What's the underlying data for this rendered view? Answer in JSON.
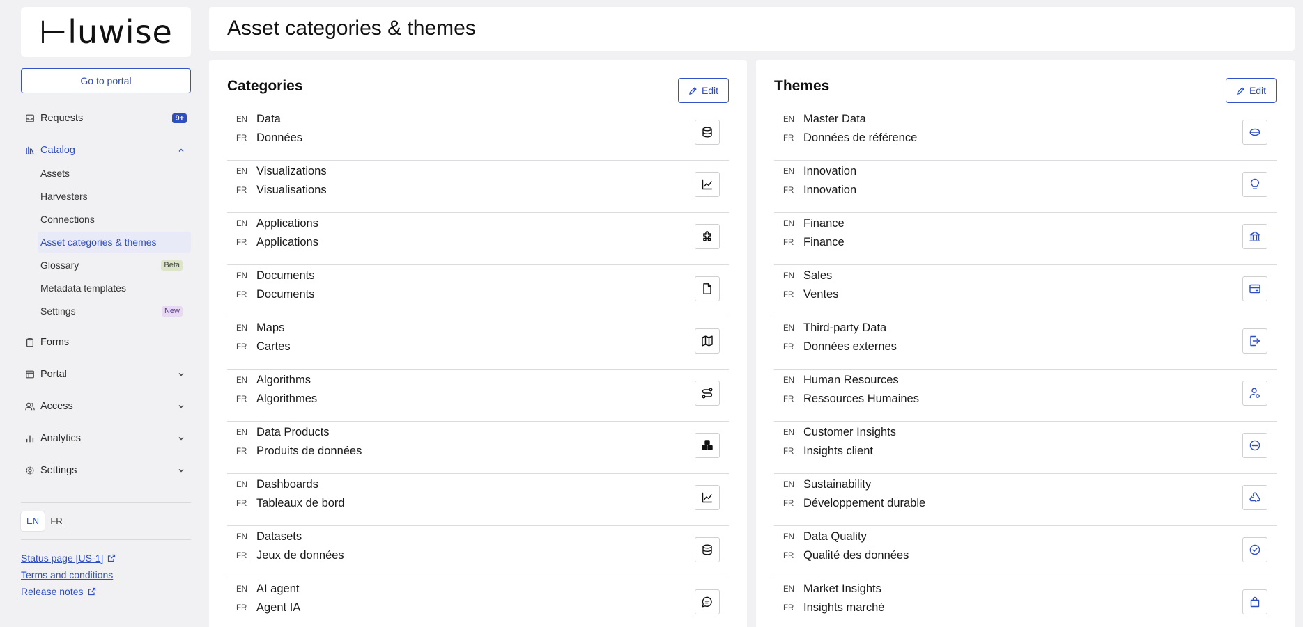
{
  "sidebar": {
    "logo": "⊢luwise",
    "portal_button": "Go to portal",
    "nav": {
      "requests": {
        "label": "Requests",
        "badge": "9+"
      },
      "catalog": {
        "label": "Catalog"
      },
      "catalog_items": {
        "assets": "Assets",
        "harvesters": "Harvesters",
        "connections": "Connections",
        "asset_categories": "Asset categories & themes",
        "glossary": "Glossary",
        "glossary_tag": "Beta",
        "metadata_templates": "Metadata templates",
        "settings": "Settings",
        "settings_tag": "New"
      },
      "forms": {
        "label": "Forms"
      },
      "portal": {
        "label": "Portal"
      },
      "access": {
        "label": "Access"
      },
      "analytics": {
        "label": "Analytics"
      },
      "settings": {
        "label": "Settings"
      }
    },
    "languages": [
      "EN",
      "FR"
    ],
    "links": {
      "status": "Status page [US-1]",
      "terms": "Terms and conditions",
      "release": "Release notes"
    }
  },
  "page": {
    "title": "Asset categories & themes"
  },
  "categories": {
    "title": "Categories",
    "edit_label": "Edit",
    "items": [
      {
        "en": "Data",
        "fr": "Données",
        "icon": "database-icon"
      },
      {
        "en": "Visualizations",
        "fr": "Visualisations",
        "icon": "line-chart-icon"
      },
      {
        "en": "Applications",
        "fr": "Applications",
        "icon": "puzzle-icon"
      },
      {
        "en": "Documents",
        "fr": "Documents",
        "icon": "file-icon"
      },
      {
        "en": "Maps",
        "fr": "Cartes",
        "icon": "map-icon"
      },
      {
        "en": "Algorithms",
        "fr": "Algorithmes",
        "icon": "route-icon"
      },
      {
        "en": "Data Products",
        "fr": "Produits de données",
        "icon": "boxes-icon"
      },
      {
        "en": "Dashboards",
        "fr": "Tableaux de bord",
        "icon": "line-chart-icon"
      },
      {
        "en": "Datasets",
        "fr": "Jeux de données",
        "icon": "database-icon"
      },
      {
        "en": "AI agent",
        "fr": "Agent IA",
        "icon": "chat-icon"
      }
    ]
  },
  "themes": {
    "title": "Themes",
    "edit_label": "Edit",
    "items": [
      {
        "en": "Master Data",
        "fr": "Données de référence",
        "icon": "disc-icon"
      },
      {
        "en": "Innovation",
        "fr": "Innovation",
        "icon": "lightbulb-icon"
      },
      {
        "en": "Finance",
        "fr": "Finance",
        "icon": "bank-icon"
      },
      {
        "en": "Sales",
        "fr": "Ventes",
        "icon": "card-icon"
      },
      {
        "en": "Third-party Data",
        "fr": "Données externes",
        "icon": "export-icon"
      },
      {
        "en": "Human Resources",
        "fr": "Ressources Humaines",
        "icon": "user-gear-icon"
      },
      {
        "en": "Customer Insights",
        "fr": "Insights client",
        "icon": "message-icon"
      },
      {
        "en": "Sustainability",
        "fr": "Développement durable",
        "icon": "recycle-icon"
      },
      {
        "en": "Data Quality",
        "fr": "Qualité des données",
        "icon": "check-circle-icon"
      },
      {
        "en": "Market Insights",
        "fr": "Insights marché",
        "icon": "bag-icon"
      }
    ]
  },
  "labels": {
    "en": "EN",
    "fr": "FR"
  },
  "colors": {
    "accent": "#2f4ec0",
    "background": "#f1f1f3"
  }
}
